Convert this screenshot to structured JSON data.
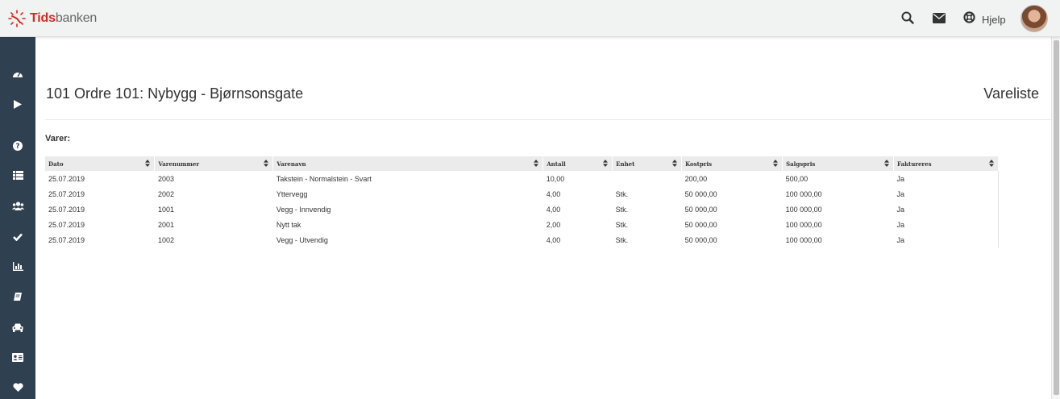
{
  "brand": {
    "name_bold": "Tids",
    "name_regular": "banken"
  },
  "header": {
    "help_label": "Hjelp"
  },
  "icons": {
    "search": "search-icon",
    "mail": "envelope-icon",
    "help": "lifebuoy-icon",
    "sidebar": [
      "dashboard-icon",
      "play-icon",
      "question-icon",
      "list-icon",
      "users-icon",
      "check-icon",
      "bar-chart-icon",
      "book-icon",
      "car-icon",
      "id-card-icon",
      "heart-icon"
    ]
  },
  "colors": {
    "sidebar": "#2f4050",
    "brand_red": "#d52b1e",
    "header_bg": "#f1f2f2"
  },
  "page": {
    "title": "101 Ordre 101: Nybygg - Bjørnsonsgate",
    "right_title": "Vareliste"
  },
  "section": {
    "label": "Varer:"
  },
  "table": {
    "columns": [
      "Dato",
      "Varenummer",
      "Varenavn",
      "Antall",
      "Enhet",
      "Kostpris",
      "Salgspris",
      "Faktureres"
    ],
    "rows": [
      [
        "25.07.2019",
        "2003",
        "Takstein - Normalstein - Svart",
        "10,00",
        "",
        "200,00",
        "500,00",
        "Ja"
      ],
      [
        "25.07.2019",
        "2002",
        "Yttervegg",
        "4,00",
        "Stk.",
        "50 000,00",
        "100 000,00",
        "Ja"
      ],
      [
        "25.07.2019",
        "1001",
        "Vegg - Innvendig",
        "4,00",
        "Stk.",
        "50 000,00",
        "100 000,00",
        "Ja"
      ],
      [
        "25.07.2019",
        "2001",
        "Nytt tak",
        "2,00",
        "Stk.",
        "50 000,00",
        "100 000,00",
        "Ja"
      ],
      [
        "25.07.2019",
        "1002",
        "Vegg - Utvendig",
        "4,00",
        "Stk.",
        "50 000,00",
        "100 000,00",
        "Ja"
      ]
    ]
  }
}
